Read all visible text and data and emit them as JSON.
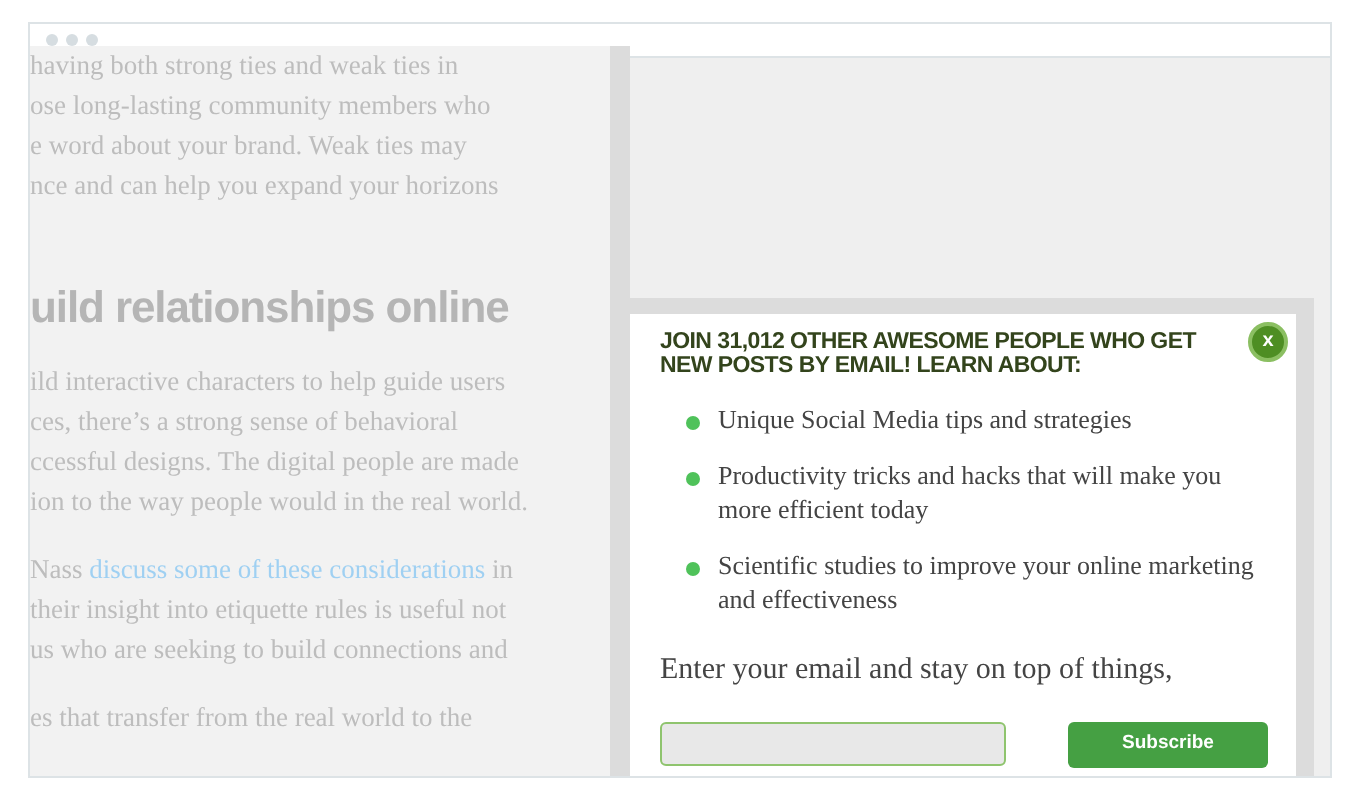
{
  "article": {
    "blocks": [
      {
        "kind": "paragraph",
        "lines": [
          {
            "text": "having both strong ties and weak ties in"
          },
          {
            "text": "ose long-lasting community members who"
          },
          {
            "text": "e word about your brand. Weak ties may"
          },
          {
            "text": "nce and can help you expand your horizons"
          }
        ]
      },
      {
        "kind": "heading",
        "text": "uild relationships online"
      },
      {
        "kind": "paragraph",
        "lines": [
          {
            "text": "ild interactive characters to help guide users"
          },
          {
            "text": "ces, there’s a strong sense of behavioral"
          },
          {
            "text": "ccessful designs. The digital people are made"
          },
          {
            "text": "ion to the way people would in the real world."
          }
        ]
      },
      {
        "kind": "paragraph",
        "lines": [
          {
            "before": "Nass ",
            "link": "discuss some of these considerations",
            "after": " in"
          },
          {
            "text": "their insight into etiquette rules is useful not"
          },
          {
            "text": "us who are seeking to build connections and"
          }
        ]
      },
      {
        "kind": "paragraph",
        "lines": [
          {
            "text": "es that transfer from the real world to the"
          }
        ]
      }
    ]
  },
  "popup": {
    "heading": "JOIN 31,012 OTHER AWESOME PEOPLE WHO GET NEW POSTS BY EMAIL! LEARN ABOUT:",
    "close_label": "x",
    "bullets": [
      "Unique Social Media tips and strategies",
      "Productivity tricks and hacks that will make you more efficient today",
      "Scientific studies to improve your online marketing and effectiveness"
    ],
    "prompt": "Enter your email and stay on top of things,",
    "subscribe_button": "Subscribe"
  }
}
